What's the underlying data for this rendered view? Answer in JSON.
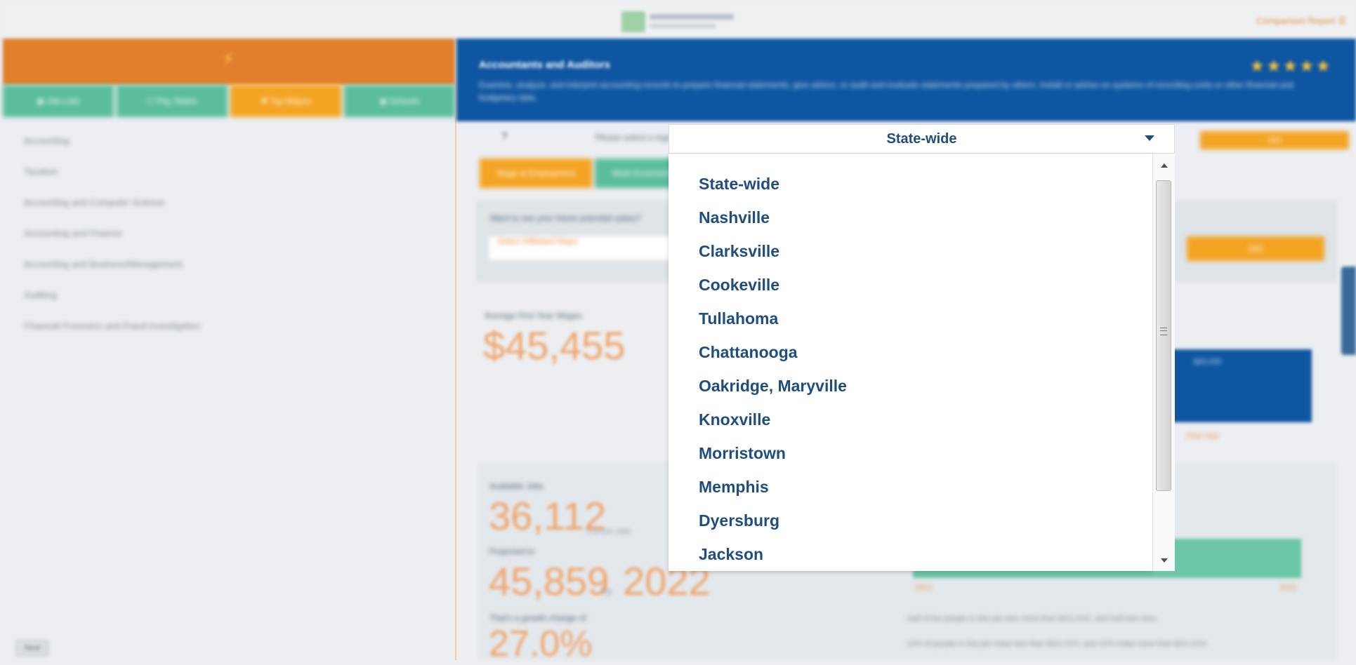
{
  "header": {
    "compare_label": "Comparison Report ☰"
  },
  "left_panel": {
    "tabs": [
      {
        "label": "◉ Job Lists",
        "active": false
      },
      {
        "label": "☐ Pay Tables",
        "active": false
      },
      {
        "label": "✚ Top Majors",
        "active": true
      },
      {
        "label": "◉ Schools",
        "active": false
      }
    ],
    "majors": [
      "Accounting",
      "Taxation",
      "Accounting and Computer Science",
      "Accounting and Finance",
      "Accounting and Business/Management",
      "Auditing",
      "Financial Forensics and Fraud Investigation"
    ],
    "bottom_button": "Next"
  },
  "career": {
    "title": "Accountants and Auditors",
    "description": "Examine, analyze, and interpret accounting records to prepare financial statements, give advice, or audit and evaluate statements prepared by others. Install or advise on systems of recording costs or other financial and budgetary data.",
    "stars": "★★★★★"
  },
  "region": {
    "help_icon": "?",
    "prompt": "Please select a region",
    "selected": "State-wide",
    "options": [
      "State-wide",
      "Nashville",
      "Clarksville",
      "Cookeville",
      "Tullahoma",
      "Chattanooga",
      "Oakridge, Maryville",
      "Knoxville",
      "Morristown",
      "Memphis",
      "Dyersburg",
      "Jackson"
    ],
    "go_label": "GO"
  },
  "subtabs": [
    {
      "label": "Wage & Employment",
      "active": true
    },
    {
      "label": "Work Environment",
      "active": false
    }
  ],
  "search": {
    "label": "Want to see your future potential salary?",
    "placeholder": "Select Affiliated Major",
    "go_label": "GO"
  },
  "wage": {
    "label": "Average First Year Wages",
    "value": "$45,455",
    "bar_label": "$45,455",
    "bar_caption": "First Year"
  },
  "jobs": {
    "label": "Available Jobs",
    "current_value": "36,112",
    "current_caption": "Current Jobs",
    "projected_label": "Projected to",
    "projected_value": "45,859",
    "by_label": "by",
    "year": "2022",
    "growth_label": "That's a growth change of",
    "growth_value": "27.0%",
    "bar_left": "2012",
    "bar_right": "2022",
    "note1": "Half of the people in this job earn more than $XX,XXX, and half earn less.",
    "note2": "10% of people in this job make less than $XX,XXX, and 10% make more than $XX,XXX."
  },
  "colors": {
    "orange": "#e27f2c",
    "amber": "#f3a423",
    "teal": "#5bbd9b",
    "navy": "#0e56a1",
    "option_text": "#1f4d7e"
  }
}
